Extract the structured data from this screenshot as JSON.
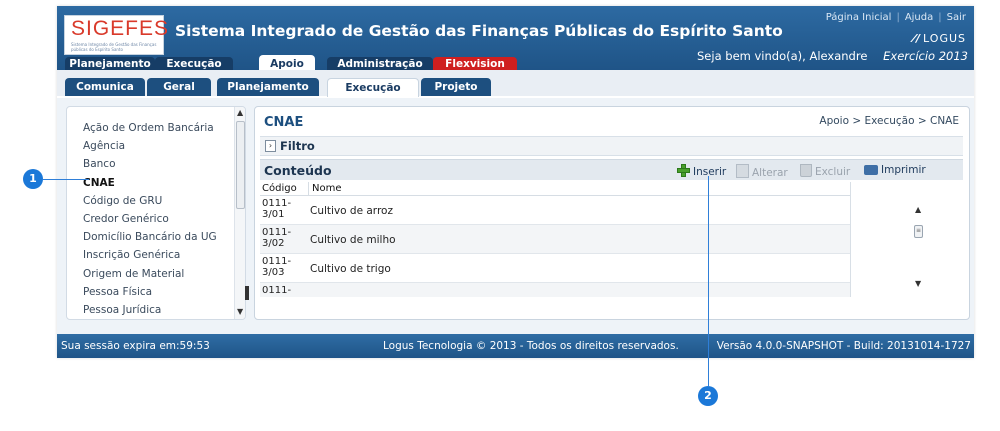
{
  "header": {
    "logo_word": "SIGEFES",
    "logo_sub": "Sistema Integrado de Gestão das Finanças públicas do Espírito Santo",
    "title": "Sistema Integrado de Gestão das Finanças Públicas do Espírito Santo",
    "links": [
      "Página Inicial",
      "Ajuda",
      "Sair"
    ],
    "brand": "LOGUS",
    "welcome": "Seja bem vindo(a), Alexandre",
    "exercise": "Exercício 2013"
  },
  "main_tabs": [
    "Planejamento",
    "Execução",
    "Apoio",
    "Administração",
    "Flexvision"
  ],
  "sub_tabs": [
    "Comunica",
    "Geral",
    "Planejamento",
    "Execução",
    "Projeto"
  ],
  "sidebar": {
    "items": [
      "Ação de Ordem Bancária",
      "Agência",
      "Banco",
      "CNAE",
      "Código de GRU",
      "Credor Genérico",
      "Domicílio Bancário da UG",
      "Inscrição Genérica",
      "Origem de Material",
      "Pessoa Física",
      "Pessoa Jurídica"
    ]
  },
  "content": {
    "title": "CNAE",
    "breadcrumb": "Apoio > Execução > CNAE",
    "filter_label": "Filtro",
    "section_label": "Conteúdo",
    "toolbar": {
      "insert": "Inserir",
      "edit": "Alterar",
      "delete": "Excluir",
      "print": "Imprimir"
    },
    "table": {
      "headers": [
        "Código",
        "Nome"
      ],
      "rows": [
        {
          "code": "0111-\n3/01",
          "name": "Cultivo de arroz"
        },
        {
          "code": "0111-\n3/02",
          "name": "Cultivo de milho"
        },
        {
          "code": "0111-\n3/03",
          "name": "Cultivo de trigo"
        },
        {
          "code": "0111-",
          "name": ""
        }
      ]
    }
  },
  "footer": {
    "session": "Sua sessão expira em:59:53",
    "copyright": "Logus Tecnologia © 2013 - Todos os direitos reservados.",
    "version": "Versão 4.0.0-SNAPSHOT - Build: 20131014-1727"
  },
  "callouts": [
    "1",
    "2"
  ],
  "colors": {
    "header_blue": "#2d6aa2",
    "tab_dark": "#163d66",
    "tab_red": "#cf1f1f",
    "logo_red": "#d93a2b",
    "callout_blue": "#1b78d8"
  }
}
